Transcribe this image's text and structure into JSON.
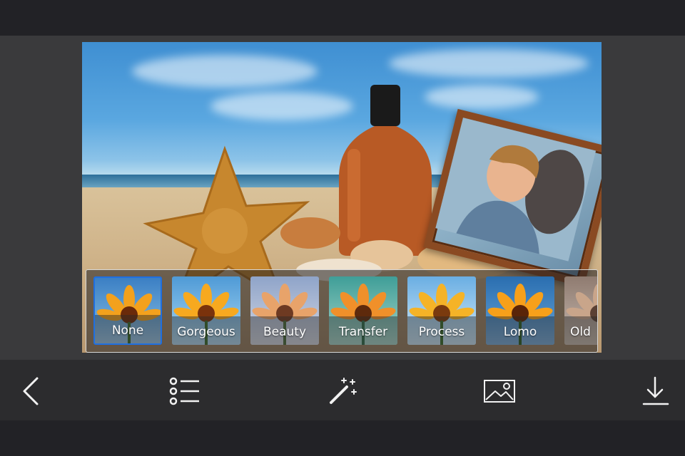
{
  "editor": {
    "filters": [
      {
        "label": "None",
        "selected": true
      },
      {
        "label": "Gorgeous",
        "selected": false
      },
      {
        "label": "Beauty",
        "selected": false
      },
      {
        "label": "Transfer",
        "selected": false
      },
      {
        "label": "Process",
        "selected": false
      },
      {
        "label": "Lomo",
        "selected": false
      },
      {
        "label": "Old",
        "selected": false
      }
    ],
    "accent_color": "#1f6fe0"
  },
  "toolbar": {
    "icons": [
      "back-arrow-icon",
      "list-icon",
      "magic-wand-icon",
      "image-icon",
      "download-icon"
    ]
  }
}
